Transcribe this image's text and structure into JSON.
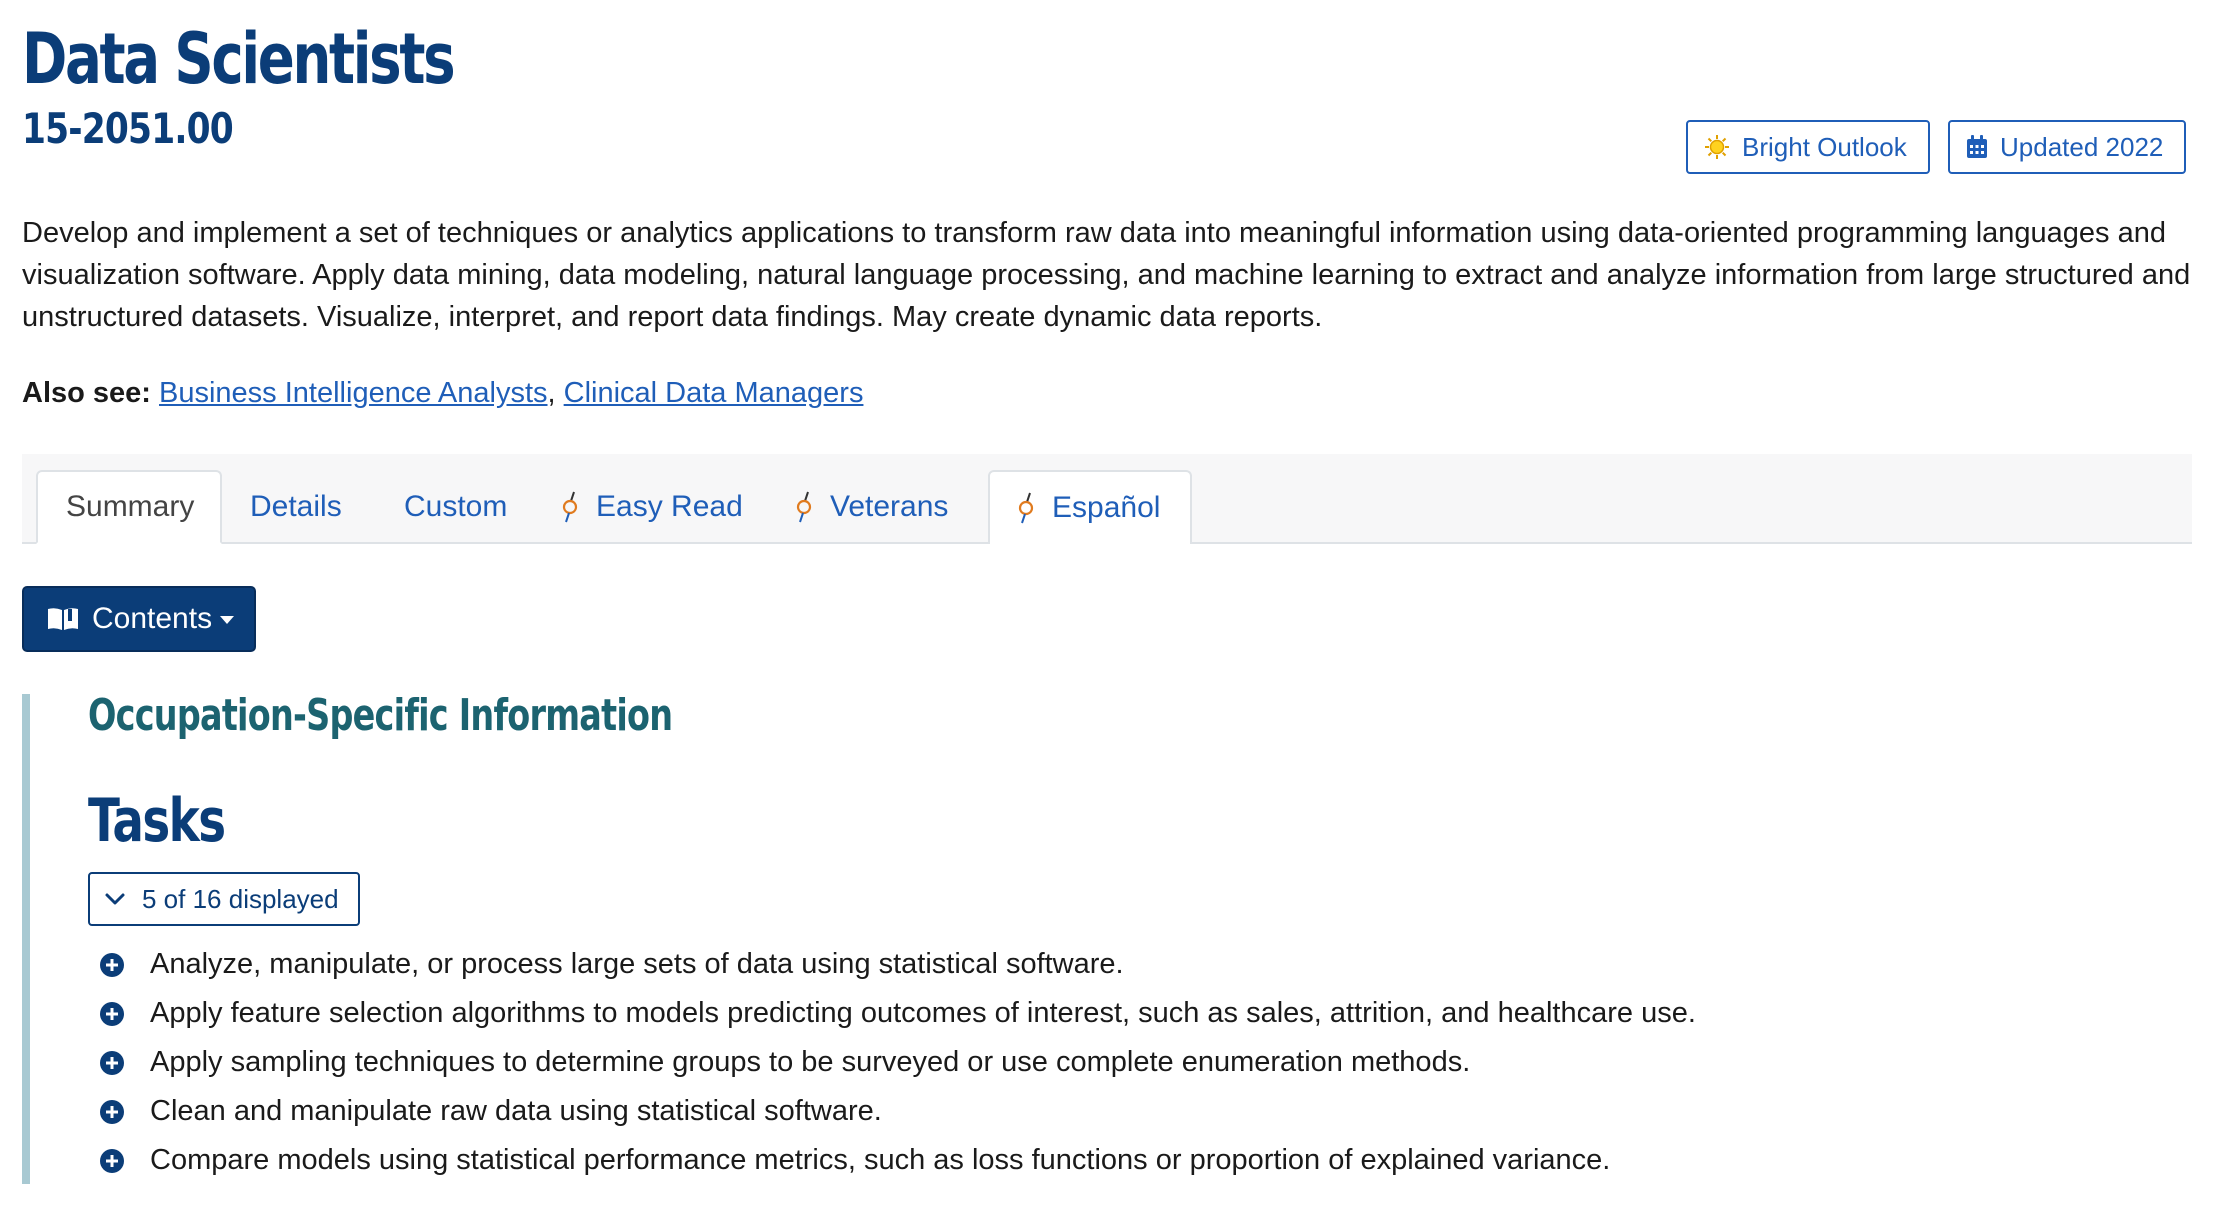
{
  "header": {
    "title": "Data Scientists",
    "code": "15-2051.00",
    "badges": [
      {
        "label": "Bright Outlook",
        "icon": "sun-icon"
      },
      {
        "label": "Updated 2022",
        "icon": "calendar-icon"
      }
    ]
  },
  "description": "Develop and implement a set of techniques or analytics applications to transform raw data into meaningful information using data-oriented programming languages and visualization software. Apply data mining, data modeling, natural language processing, and machine learning to extract and analyze information from large structured and unstructured datasets. Visualize, interpret, and report data findings. May create dynamic data reports.",
  "also_see": {
    "label": "Also see:",
    "links": [
      "Business Intelligence Analysts",
      "Clinical Data Managers"
    ],
    "separator": ","
  },
  "tabs": [
    {
      "label": "Summary",
      "active": true
    },
    {
      "label": "Details"
    },
    {
      "label": "Custom"
    },
    {
      "label": "Easy Read",
      "icon": "external-variant-icon"
    },
    {
      "label": "Veterans",
      "icon": "external-variant-icon"
    },
    {
      "label": "Español",
      "icon": "external-variant-icon"
    }
  ],
  "contents_button": {
    "label": "Contents",
    "icon": "book-open-icon"
  },
  "section": {
    "heading": "Occupation-Specific Information",
    "tasks_heading": "Tasks",
    "displayed_toggle": "5 of 16 displayed",
    "tasks": [
      "Analyze, manipulate, or process large sets of data using statistical software.",
      "Apply feature selection algorithms to models predicting outcomes of interest, such as sales, attrition, and healthcare use.",
      "Apply sampling techniques to determine groups to be surveyed or use complete enumeration methods.",
      "Clean and manipulate raw data using statistical software.",
      "Compare models using statistical performance metrics, such as loss functions or proportion of explained variance."
    ]
  },
  "colors": {
    "title": "#0b3d78",
    "link": "#1f5eb8",
    "section_heading": "#1c6370",
    "section_bar": "#a8c9d2",
    "button_bg": "#0b3d78"
  }
}
